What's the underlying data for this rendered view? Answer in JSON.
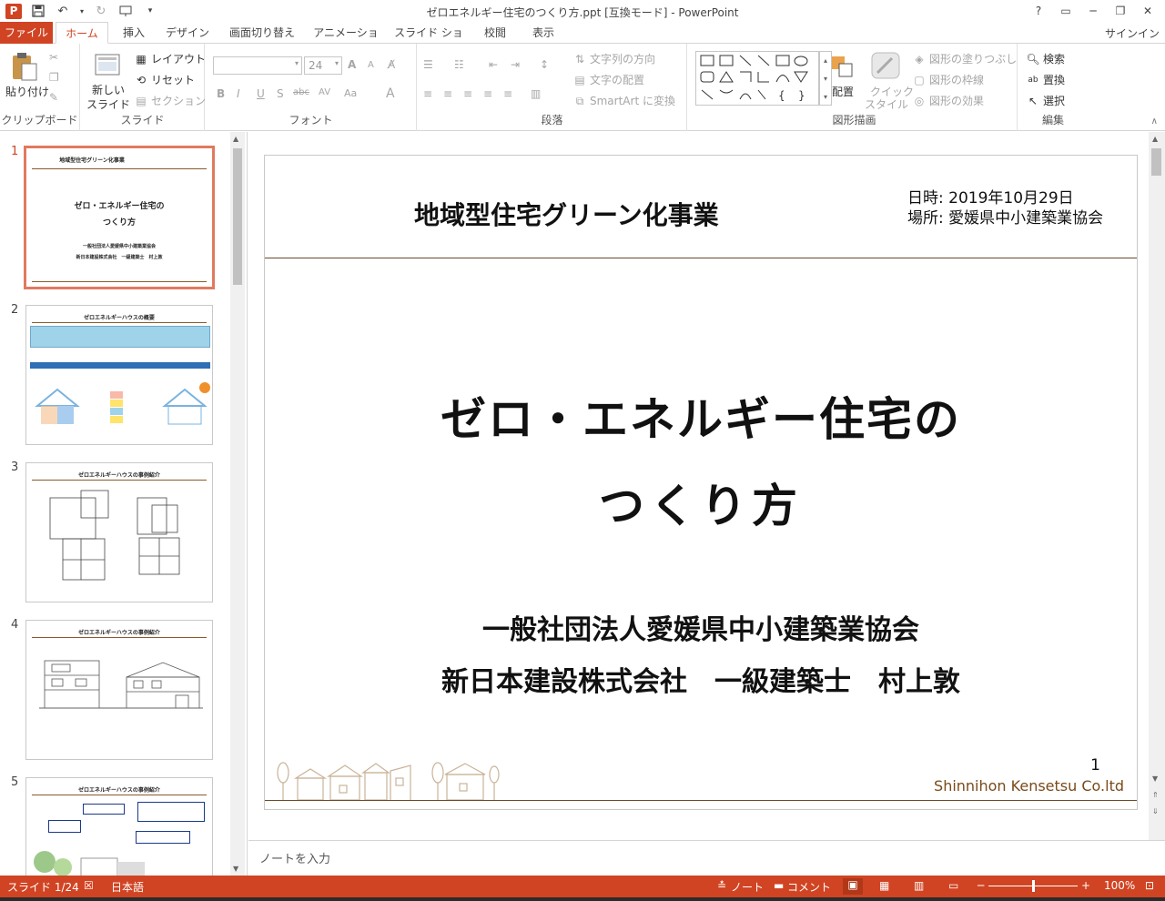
{
  "window": {
    "title": "ゼロエネルギー住宅のつくり方.ppt [互換モード] - PowerPoint",
    "help": "?",
    "controls": [
      "▭",
      "─",
      "❐",
      "✕"
    ],
    "sign_in": "サインイン"
  },
  "tabs": [
    "ファイル",
    "ホーム",
    "挿入",
    "デザイン",
    "画面切り替え",
    "アニメーション",
    "スライド ショー",
    "校閲",
    "表示"
  ],
  "ribbon": {
    "clipboard": {
      "paste": "貼り付け",
      "label": "クリップボード"
    },
    "slides": {
      "new_slide": "新しい",
      "new_slide2": "スライド",
      "layout": "レイアウト",
      "reset": "リセット",
      "section": "セクション",
      "label": "スライド"
    },
    "font": {
      "font_size": "24",
      "label": "フォント",
      "bold": "B",
      "italic": "I",
      "underline": "U",
      "shadow": "S",
      "strike": "abc",
      "spacing": "AV",
      "case": "Aa",
      "grow": "A",
      "shrink": "A"
    },
    "paragraph": {
      "text_direction": "文字列の方向",
      "align_text": "文字の配置",
      "smartart": "SmartArt に変換",
      "label": "段落"
    },
    "drawing": {
      "arrange": "配置",
      "quick_styles": "クイック",
      "quick_styles2": "スタイル",
      "fill": "図形の塗りつぶし",
      "outline": "図形の枠線",
      "effects": "図形の効果",
      "label": "図形描画"
    },
    "editing": {
      "find": "検索",
      "replace": "置換",
      "select": "選択",
      "label": "編集"
    }
  },
  "thumbnails": [
    {
      "num": "1",
      "title": "地域型住宅グリーン化事業",
      "sub1": "ゼロ・エネルギー住宅の",
      "sub2": "つくり方",
      "org1": "一般社団法人愛媛県中小建築業協会",
      "org2": "新日本建設株式会社　一級建築士　村上敦"
    },
    {
      "num": "2",
      "title": "ゼロエネルギーハウスの概要"
    },
    {
      "num": "3",
      "title": "ゼロエネルギーハウスの事例紹介"
    },
    {
      "num": "4",
      "title": "ゼロエネルギーハウスの事例紹介"
    },
    {
      "num": "5",
      "title": "ゼロエネルギーハウスの事例紹介"
    }
  ],
  "slide": {
    "header": "地域型住宅グリーン化事業",
    "date": "日時: 2019年10月29日",
    "place": "場所: 愛媛県中小建築業協会",
    "title1": "ゼロ・エネルギー住宅の",
    "title2": "つくり方",
    "org1": "一般社団法人愛媛県中小建築業協会",
    "org2": "新日本建設株式会社　一級建築士　村上敦",
    "page": "1",
    "company": "Shinnihon Kensetsu Co.ltd"
  },
  "notes_placeholder": "ノートを入力",
  "status": {
    "slide": "スライド 1/24",
    "language": "日本語",
    "notes": "ノート",
    "comments": "コメント",
    "zoom": "100%"
  }
}
